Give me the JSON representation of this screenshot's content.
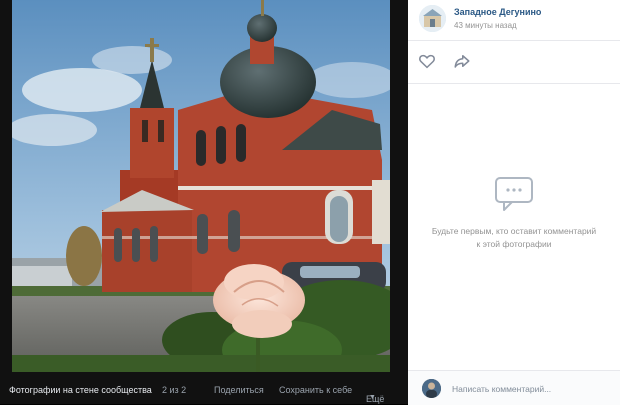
{
  "viewer": {
    "album_link": "Фотографии на стене сообщества",
    "counter": "2 из 2",
    "share": "Поделиться",
    "save": "Сохранить к себе",
    "more": "Ещё"
  },
  "panel": {
    "community_name": "Западное Дегунино",
    "posted_time": "43 минуты назад",
    "empty_text": "Будьте первым, кто оставит комментарий к этой фотографии",
    "comment_placeholder": "Написать комментарий..."
  },
  "icons": {
    "like": "heart-icon",
    "share": "share-arrow-icon",
    "empty": "comments-bubble-icon",
    "more": "chevron-down-icon"
  },
  "colors": {
    "link": "#2a5885",
    "muted": "#939393",
    "viewer_bg": "#111111"
  }
}
